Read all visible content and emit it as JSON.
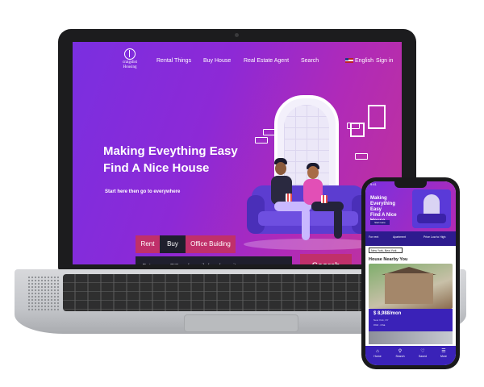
{
  "laptop": {
    "nav": {
      "logo_line1": "craigslist",
      "logo_line2": "Housing",
      "links": [
        "Rental Things",
        "Buy House",
        "Real Estate Agent",
        "Search"
      ],
      "language": "English",
      "signin": "Sign in"
    },
    "hero": {
      "title_line1": "Making Eveything Easy",
      "title_line2": "Find A Nice House",
      "subtitle": "Start here then go to everywhere"
    },
    "search": {
      "tabs": [
        "Rent",
        "Buy",
        "Office Buiding"
      ],
      "active_tab": "Buy",
      "placeholder": "Entre your ZIP code, neibrhood, or city",
      "button": "Search"
    }
  },
  "phone": {
    "status_time": "9:41",
    "hero": {
      "title_line1": "Making",
      "title_line2": "Everything",
      "title_line3": "Easy",
      "title_line4": "Find A Nice",
      "title_line5": "House",
      "button": "Start Here"
    },
    "filters": [
      "For rent",
      "Apartment",
      "Price Low to High"
    ],
    "location": "New York, New York",
    "section_title": "House Nearby You",
    "listing": {
      "price": "$ 8,988/mon",
      "address": "New York, NY",
      "meta": "3 bd · 2 ba"
    },
    "tabbar": [
      {
        "label": "Home",
        "icon": "home-icon"
      },
      {
        "label": "Search",
        "icon": "search-icon"
      },
      {
        "label": "Saved",
        "icon": "heart-icon"
      },
      {
        "label": "More",
        "icon": "menu-icon"
      }
    ]
  },
  "colors": {
    "hero_start": "#7a2fe0",
    "hero_end": "#c13399",
    "accent": "#c0306a",
    "tab_active": "#1f1f2d",
    "phone_primary": "#3a22b8"
  }
}
